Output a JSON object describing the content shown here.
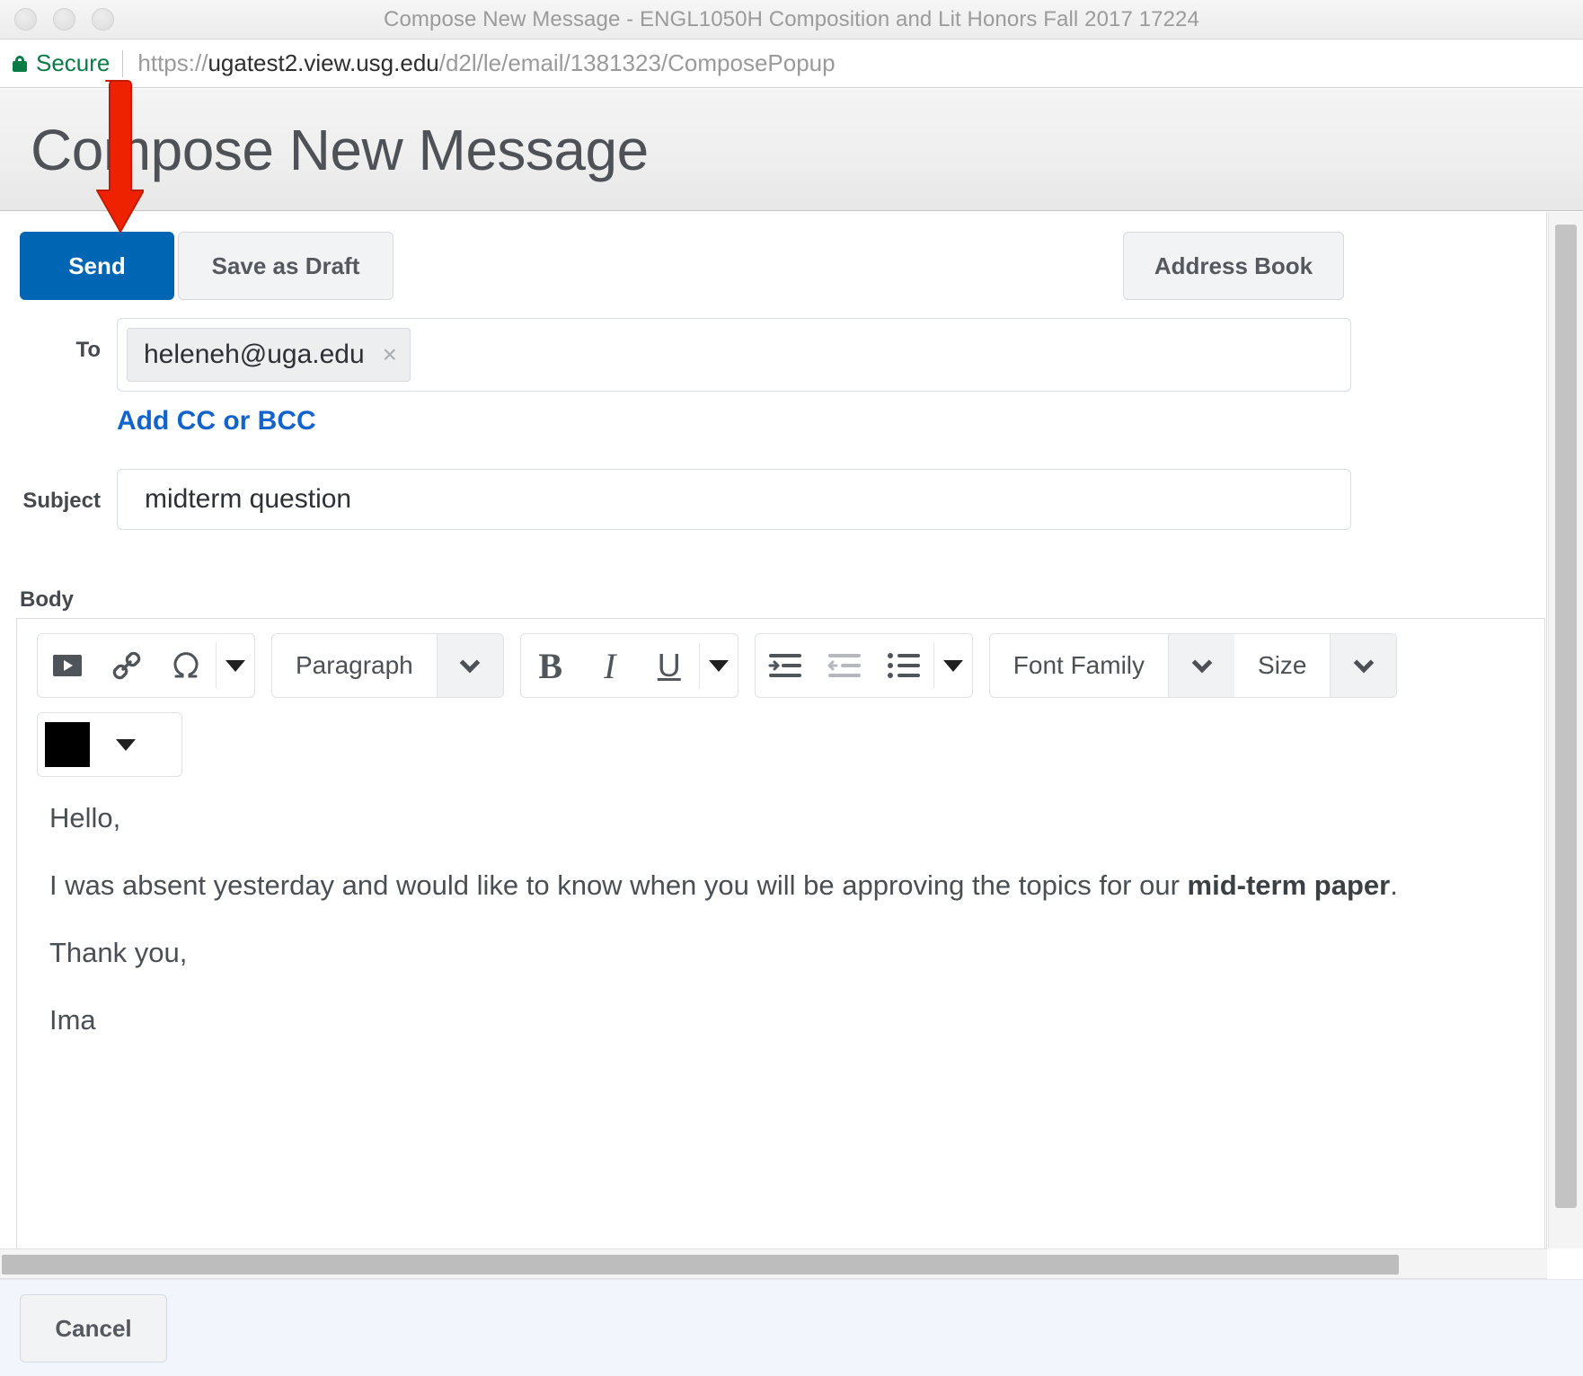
{
  "browser": {
    "window_title": "Compose New Message - ENGL1050H Composition and Lit Honors Fall 2017 17224",
    "security_label": "Secure",
    "url_scheme": "https://",
    "url_host": "ugatest2.view.usg.edu",
    "url_path": "/d2l/le/email/1381323/ComposePopup",
    "traffic_lights": [
      "close",
      "minimize",
      "zoom"
    ]
  },
  "page": {
    "title": "Compose New Message"
  },
  "toolbar": {
    "send_label": "Send",
    "save_draft_label": "Save as Draft",
    "address_book_label": "Address Book"
  },
  "fields": {
    "to_label": "To",
    "to_recipients": [
      "heleneh@uga.edu"
    ],
    "to_chip_remove": "×",
    "add_cc_bcc_label": "Add CC or BCC",
    "subject_label": "Subject",
    "subject_value": "midterm question",
    "body_label": "Body"
  },
  "editor_toolbar": {
    "insert_stuff_icon": "insert-media-icon",
    "link_icon": "link-icon",
    "symbol_icon": "omega-symbol-icon",
    "more_caret": "caret-down-icon",
    "paragraph_format": "Paragraph",
    "bold_icon": "B",
    "italic_icon": "I",
    "underline_icon": "U",
    "indent_icon": "indent-icon",
    "outdent_icon": "outdent-icon",
    "bullet_list_icon": "bullet-list-icon",
    "font_family": "Font Family",
    "font_size": "Size",
    "text_color": "#000000"
  },
  "body": {
    "paragraphs": [
      {
        "before": "Hello,",
        "bold": "",
        "after": ""
      },
      {
        "before": "I was absent yesterday and would like to know when you will be approving the topics for our ",
        "bold": "mid-term paper",
        "after": "."
      },
      {
        "before": "Thank you,",
        "bold": "",
        "after": ""
      },
      {
        "before": "Ima",
        "bold": "",
        "after": ""
      }
    ]
  },
  "footer": {
    "cancel_label": "Cancel"
  },
  "annotation": {
    "arrow_color": "#ee2200",
    "points_to": "send-button"
  },
  "colors": {
    "primary_button": "#0066b3",
    "link": "#1263cc",
    "secure_green": "#0b7b45"
  }
}
